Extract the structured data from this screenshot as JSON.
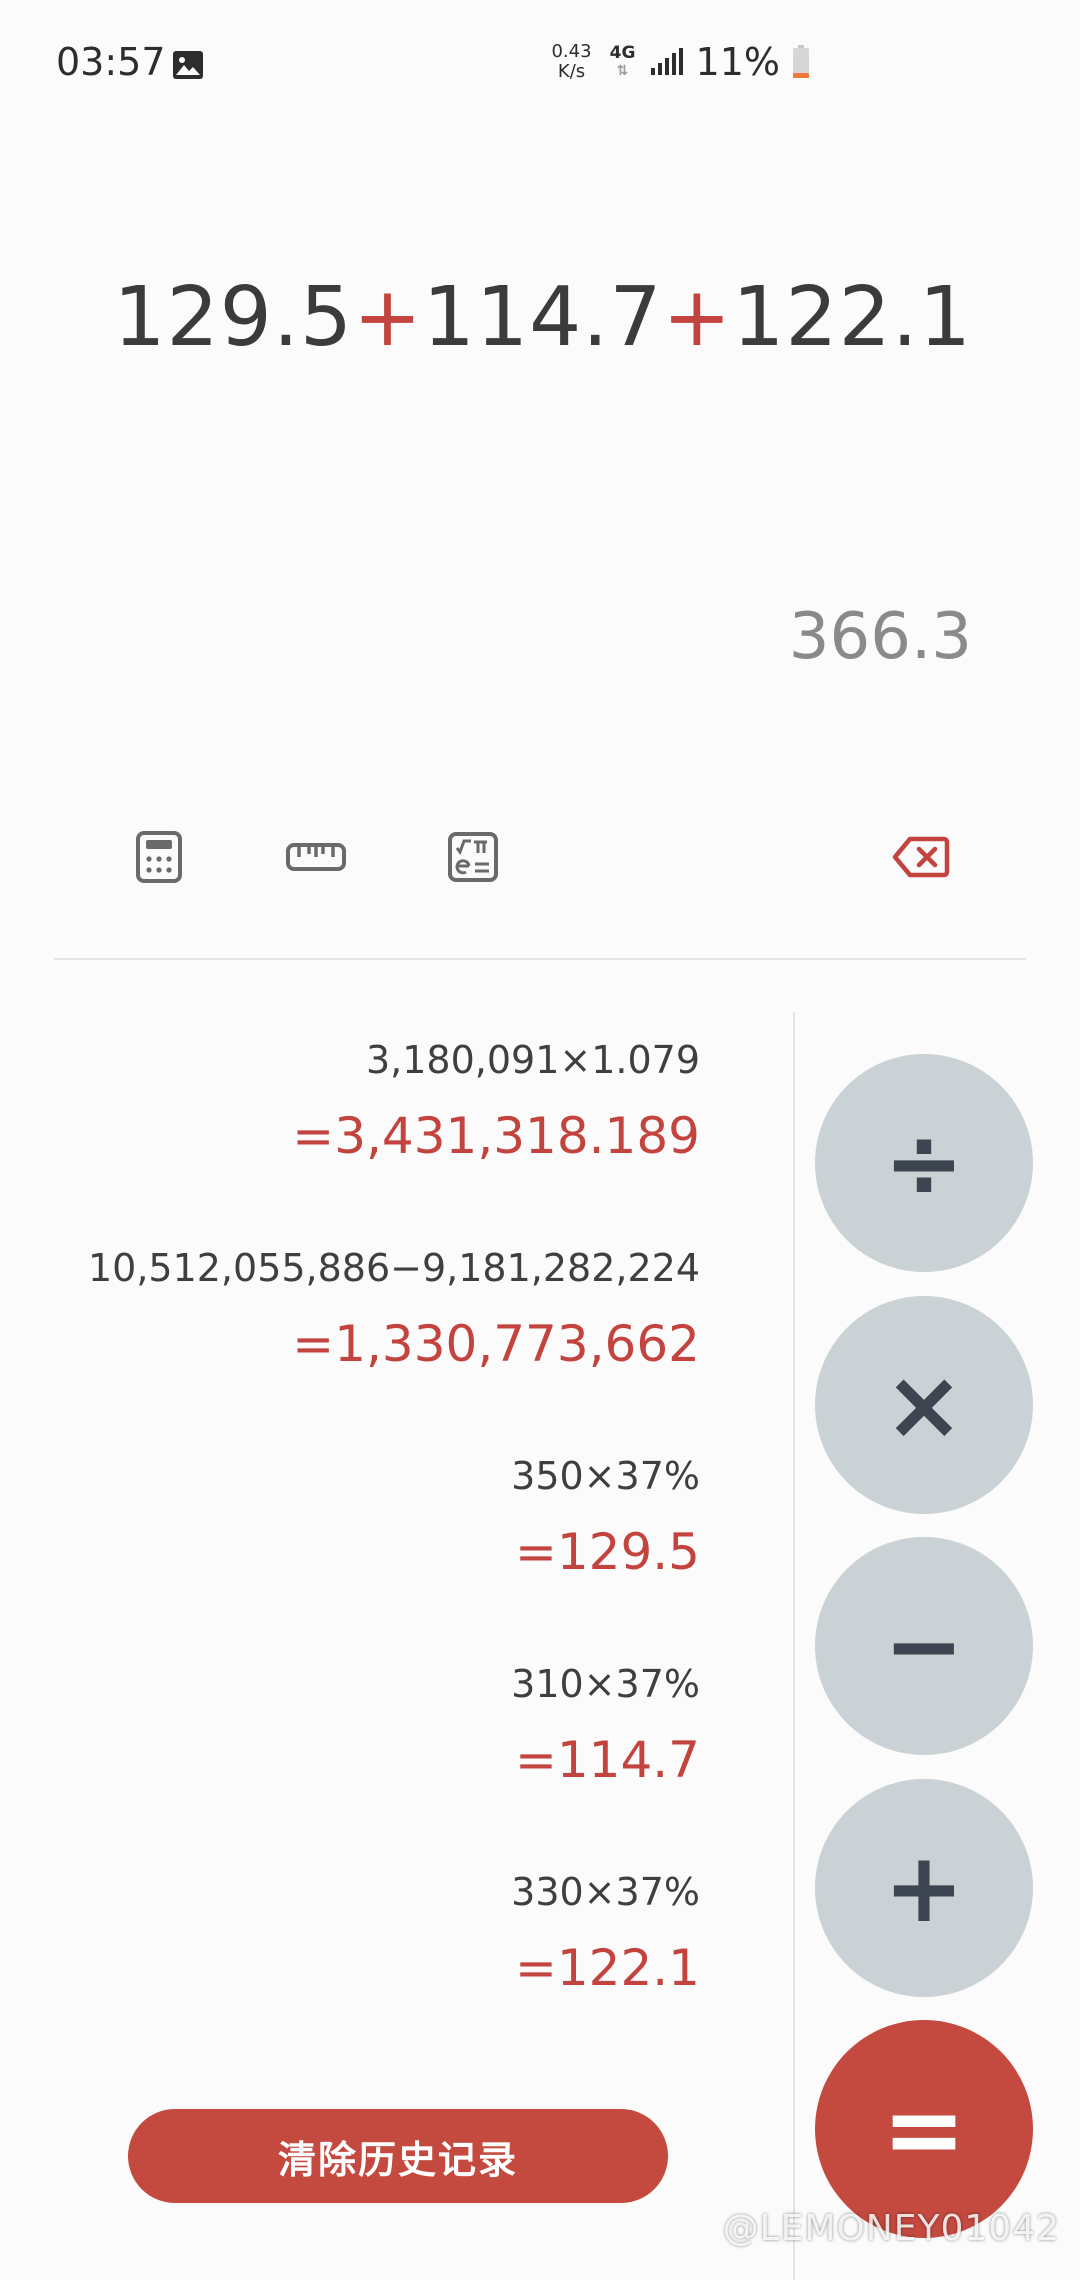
{
  "status_bar": {
    "time": "03:57",
    "net_speed_value": "0.43",
    "net_speed_unit": "K/s",
    "network_type": "4G",
    "network_arrows": "⇅",
    "battery": "11%",
    "icons": [
      "gallery-icon",
      "signal-icon",
      "battery-icon"
    ]
  },
  "display": {
    "expression": {
      "n1": "129.5",
      "op1": "+",
      "n2": "114.7",
      "op2": "+",
      "n3": "122.1"
    },
    "result": "366.3"
  },
  "toolbar": {
    "icons": [
      "calculator-icon",
      "ruler-icon",
      "scientific-icon",
      "backspace-icon"
    ]
  },
  "history": [
    {
      "expression": "3,180,091×1.079",
      "result": "=3,431,318.189"
    },
    {
      "expression": "10,512,055,886−9,181,282,224",
      "result": "=1,330,773,662"
    },
    {
      "expression": "350×37%",
      "result": "=129.5"
    },
    {
      "expression": "310×37%",
      "result": "=114.7"
    },
    {
      "expression": "330×37%",
      "result": "=122.1"
    }
  ],
  "clear_history_label": "清除历史记录",
  "operators": {
    "divide": "÷",
    "multiply": "×",
    "minus": "−",
    "plus": "+",
    "equals": "="
  },
  "colors": {
    "accent": "#c4493f",
    "operator_button_bg": "#cad2d5",
    "background": "#fbfbfb"
  },
  "watermark": "@LEMONEY01042"
}
